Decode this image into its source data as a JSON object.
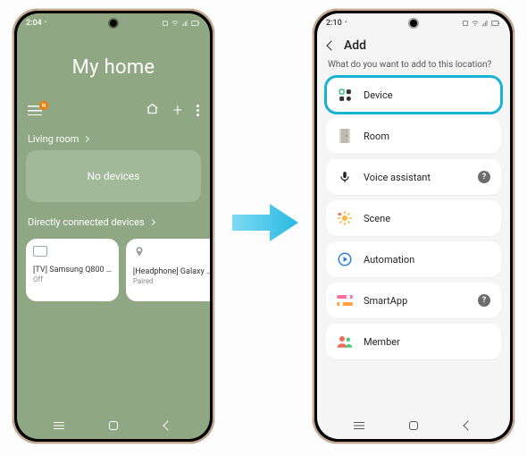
{
  "left": {
    "status": {
      "time": "2:04",
      "indicator": "⁺"
    },
    "title": "My home",
    "menu_badge": "N",
    "room": {
      "label": "Living room",
      "empty_text": "No devices"
    },
    "direct_section": "Directly connected devices",
    "devices": [
      {
        "name": "[TV] Samsung Q800 …",
        "state": "Off"
      },
      {
        "name": "[Headphone] Galaxy …",
        "state": "Paired"
      }
    ]
  },
  "right": {
    "status": {
      "time": "2:10",
      "indicator": "⁺"
    },
    "header": "Add",
    "prompt": "What do you want to add to this location?",
    "items": [
      {
        "key": "device",
        "label": "Device",
        "highlight": true
      },
      {
        "key": "room",
        "label": "Room"
      },
      {
        "key": "voice",
        "label": "Voice assistant",
        "help": true
      },
      {
        "key": "scene",
        "label": "Scene"
      },
      {
        "key": "auto",
        "label": "Automation"
      },
      {
        "key": "smartapp",
        "label": "SmartApp",
        "help": true
      },
      {
        "key": "member",
        "label": "Member"
      }
    ]
  }
}
